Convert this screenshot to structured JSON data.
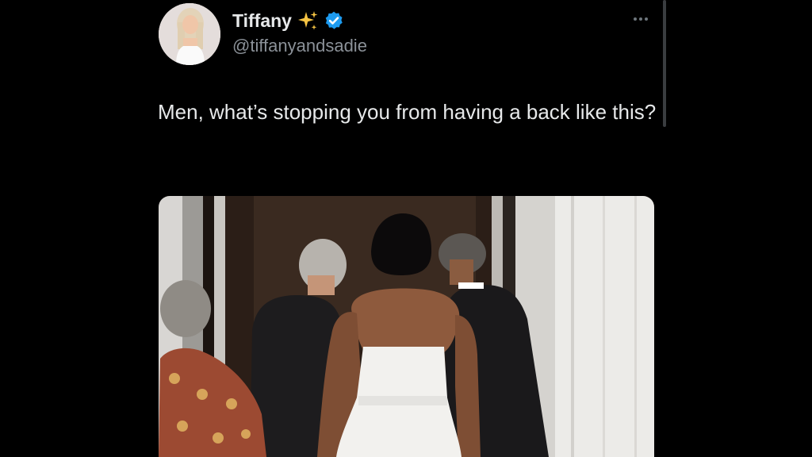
{
  "author": {
    "display_name": "Tiffany",
    "handle": "@tiffanyandsadie",
    "verified": true,
    "name_emoji": "sparkles-icon",
    "badge_icon": "verified-badge-icon",
    "badge_color": "#1d9bf0"
  },
  "tweet": {
    "text": "Men, what’s stopping you from having a back like this?"
  },
  "menu": {
    "icon": "more-options-icon"
  },
  "media": {
    "kind": "photo",
    "description_icon": "photo-image"
  },
  "colors": {
    "background": "#000000",
    "text_primary": "#e7e9ea",
    "text_secondary": "#8b9198",
    "sparkle": "#f6c443"
  }
}
